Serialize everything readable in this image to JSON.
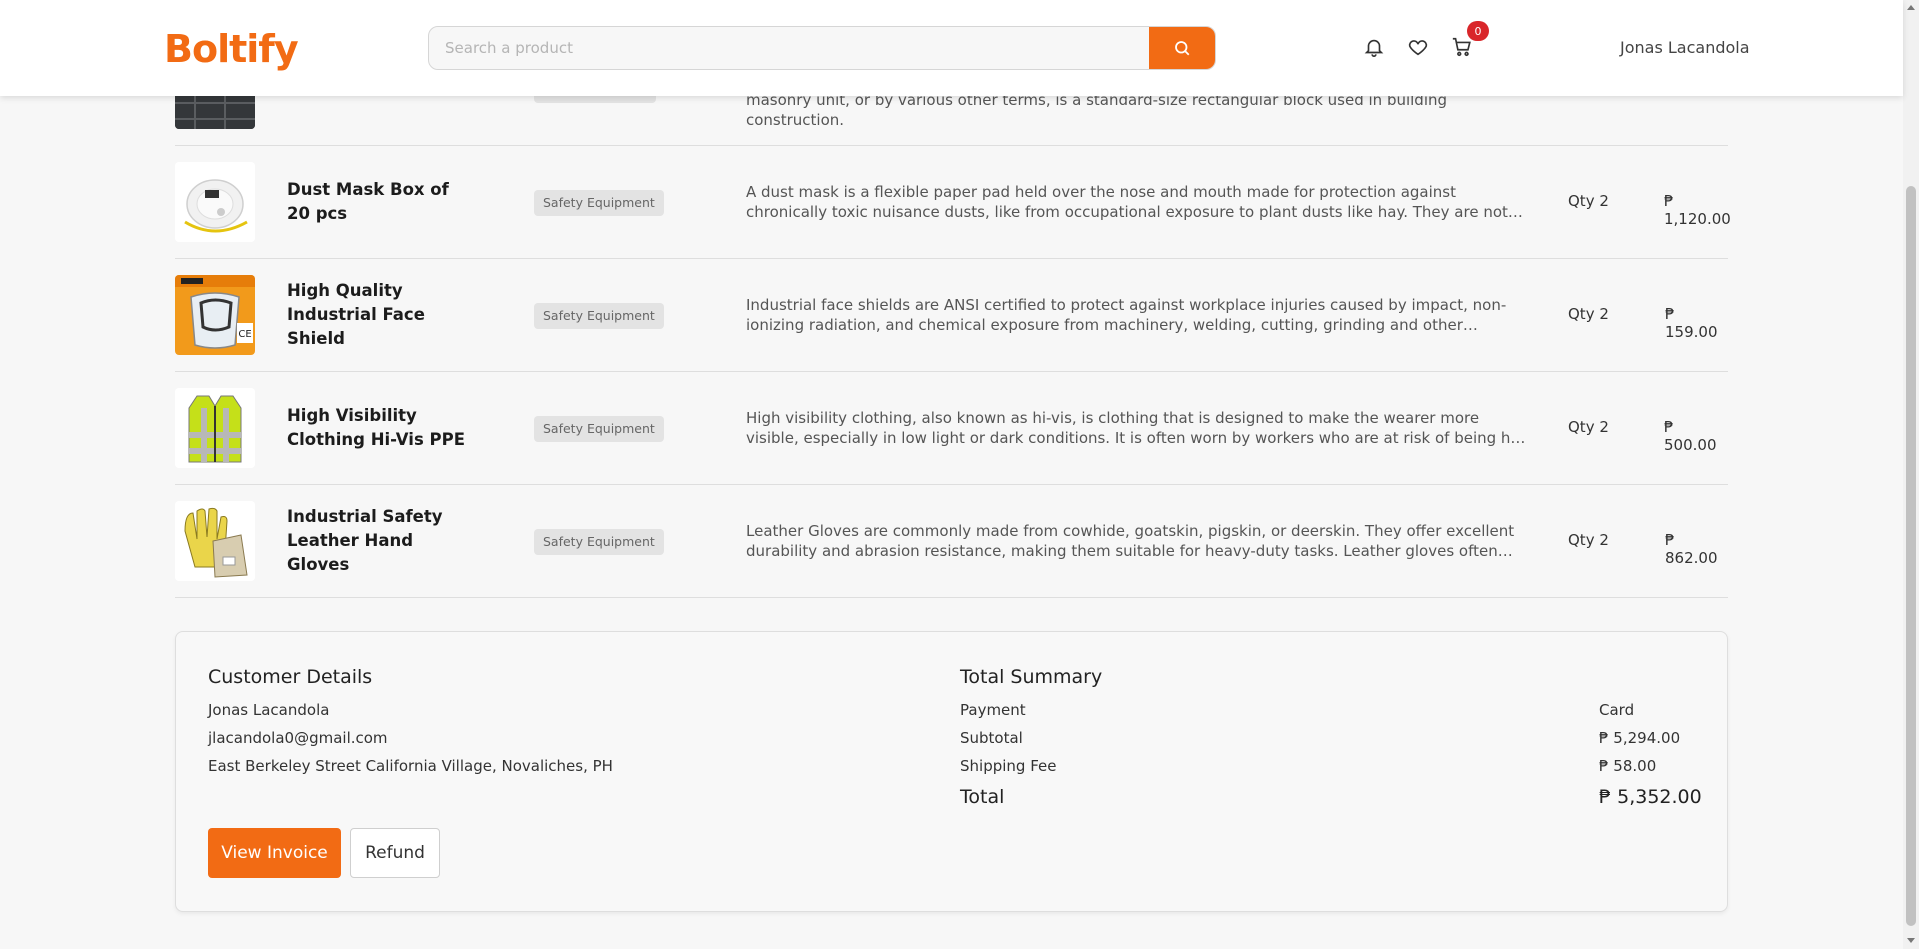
{
  "header": {
    "logo": "Boltify",
    "search_placeholder": "Search a product",
    "cart_count": "0",
    "user_name": "Jonas Lacandola"
  },
  "partial_row": {
    "description": "masonry unit, or by various other terms, is a standard-size rectangular block used in building construction."
  },
  "items": [
    {
      "name": "Dust Mask Box of 20 pcs",
      "category": "Safety Equipment",
      "description": "A dust mask is a flexible paper pad held over the nose and mouth made for protection against chronically toxic nuisance dusts, like from occupational exposure to plant dusts like hay. They are not intended to provide...",
      "qty": "Qty 2",
      "price": "₱ 1,120.00"
    },
    {
      "name": "High Quality Industrial Face Shield",
      "category": "Safety Equipment",
      "description": "Industrial face shields are ANSI certified to protect against workplace injuries caused by impact, non-ionizing radiation, and chemical exposure from machinery, welding, cutting, grinding and other potentially hazardous...",
      "qty": "Qty 2",
      "price": "₱ 159.00"
    },
    {
      "name": "High Visibility Clothing Hi-Vis PPE",
      "category": "Safety Equipment",
      "description": "High visibility clothing, also known as hi-vis, is clothing that is designed to make the wearer more visible, especially in low light or dark conditions. It is often worn by workers who are at risk of being hit by vehicles or...",
      "qty": "Qty 2",
      "price": "₱ 500.00"
    },
    {
      "name": "Industrial Safety Leather Hand Gloves",
      "category": "Safety Equipment",
      "description": "Leather Gloves are commonly made from cowhide, goatskin, pigskin, or deerskin. They offer excellent durability and abrasion resistance, making them suitable for heavy-duty tasks. Leather gloves often feature reinforced...",
      "qty": "Qty 2",
      "price": "₱ 862.00"
    }
  ],
  "customer": {
    "title": "Customer Details",
    "name": "Jonas Lacandola",
    "email": "jlacandola0@gmail.com",
    "address": "East Berkeley Street California Village, Novaliches, PH"
  },
  "summary": {
    "title": "Total Summary",
    "payment_label": "Payment",
    "payment_value": "Card",
    "subtotal_label": "Subtotal",
    "subtotal_value": "₱ 5,294.00",
    "shipping_label": "Shipping Fee",
    "shipping_value": "₱ 58.00",
    "total_label": "Total",
    "total_value": "₱ 5,352.00"
  },
  "actions": {
    "view_invoice": "View Invoice",
    "refund": "Refund"
  }
}
